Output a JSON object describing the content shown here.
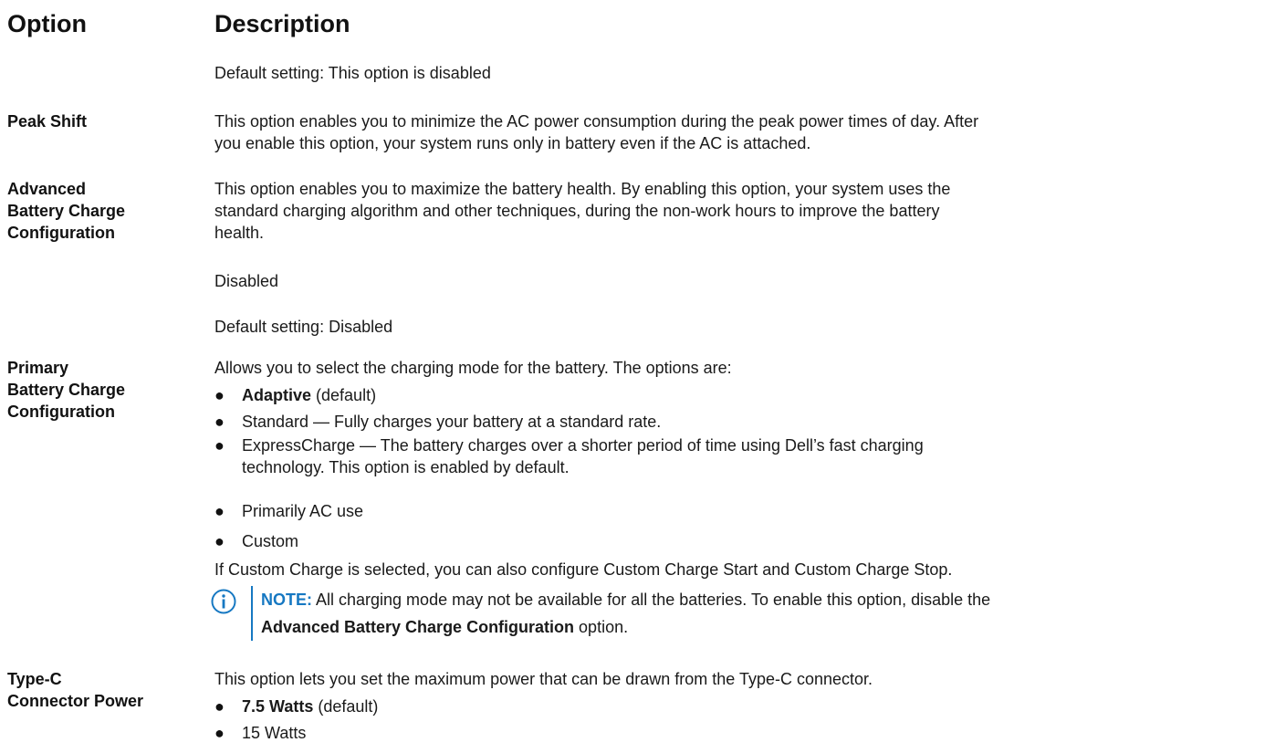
{
  "header": {
    "option": "Option",
    "description": "Description"
  },
  "rows": {
    "top": {
      "default": "Default setting: This option is disabled"
    },
    "peak_shift": {
      "name": "Peak Shift",
      "desc_line1": "This option enables you to minimize the AC power consumption during the peak power times of day. After",
      "desc_line2": "you enable this option, your system runs only in battery even if the AC is attached."
    },
    "advanced": {
      "name_line1": "Advanced",
      "name_line2": "Battery Charge",
      "name_line3": "Configuration",
      "desc_line1": "This option enables you to maximize the battery health. By enabling this option, your system uses the",
      "desc_line2": "standard charging algorithm and other techniques, during the non-work hours to improve the battery",
      "desc_line3": "health.",
      "value": "Disabled",
      "default": "Default setting: Disabled"
    },
    "primary": {
      "name_line1": "Primary",
      "name_line2": "Battery Charge",
      "name_line3": "Configuration",
      "intro": "Allows you to select the charging mode for the battery. The options are:",
      "opt1_bold": "Adaptive",
      "opt1_rest": " (default)",
      "opt2": "Standard — Fully charges your battery at a standard rate.",
      "opt3_line1": "ExpressCharge — The battery charges over a shorter period of time using Dell’s fast charging",
      "opt3_line2": "technology. This option is enabled by default.",
      "opt4": "Primarily AC use",
      "opt5": "Custom",
      "custom_note": "If Custom Charge is selected, you can also configure Custom Charge Start and Custom Charge Stop.",
      "note_label": "NOTE:",
      "note_text": " All charging mode may not be available for all the batteries. To enable this option, disable the",
      "note_bold": "Advanced Battery Charge Configuration",
      "note_end": " option."
    },
    "typec": {
      "name_line1": "Type-C",
      "name_line2": "Connector Power",
      "intro": "This option lets you set the maximum power that can be drawn from the Type-C connector.",
      "opt1_bold": "7.5 Watts",
      "opt1_rest": " (default)",
      "opt2": "15 Watts"
    }
  },
  "bullet_glyph": "●",
  "colors": {
    "note_accent": "#1678c2",
    "text": "#1a1a1a"
  }
}
